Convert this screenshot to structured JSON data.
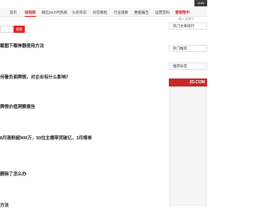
{
  "header": {
    "logo_text": "Jco0"
  },
  "nav": {
    "items": [
      {
        "label": "首页",
        "state": "normal"
      },
      {
        "label": "短视频",
        "state": "active"
      },
      {
        "label": "微信24小时热榜",
        "state": "normal"
      },
      {
        "label": "头条资讯",
        "state": "normal"
      },
      {
        "label": "抖音教程",
        "state": "normal"
      },
      {
        "label": "行业观察",
        "state": "normal"
      },
      {
        "label": "数据报告",
        "state": "normal"
      },
      {
        "label": "运营百科",
        "state": "normal"
      },
      {
        "label": "营销帮手",
        "state": "hot"
      }
    ]
  },
  "search": {
    "button_label": "搜索",
    "placeholder": ""
  },
  "articles": [
    {
      "title": "截图下载神器使用方法"
    },
    {
      "title": "何看负面舆情，对企业有什么影响？"
    },
    {
      "title": "舆情价值洞察报告"
    },
    {
      "title": "8月涨粉超900万，50位主播带货破亿，3月榜单"
    },
    {
      "title": "删除了怎么办"
    },
    {
      "title": "方法"
    }
  ],
  "sidebar": {
    "search_hint": "输入关键字",
    "widgets": [
      {
        "label": "热门文章排行"
      },
      {
        "label": "热门推荐"
      },
      {
        "label": "推荐标签"
      }
    ],
    "ad_label": "JD.COM"
  },
  "colors": {
    "accent": "#e02222",
    "ad": "#c62828"
  }
}
